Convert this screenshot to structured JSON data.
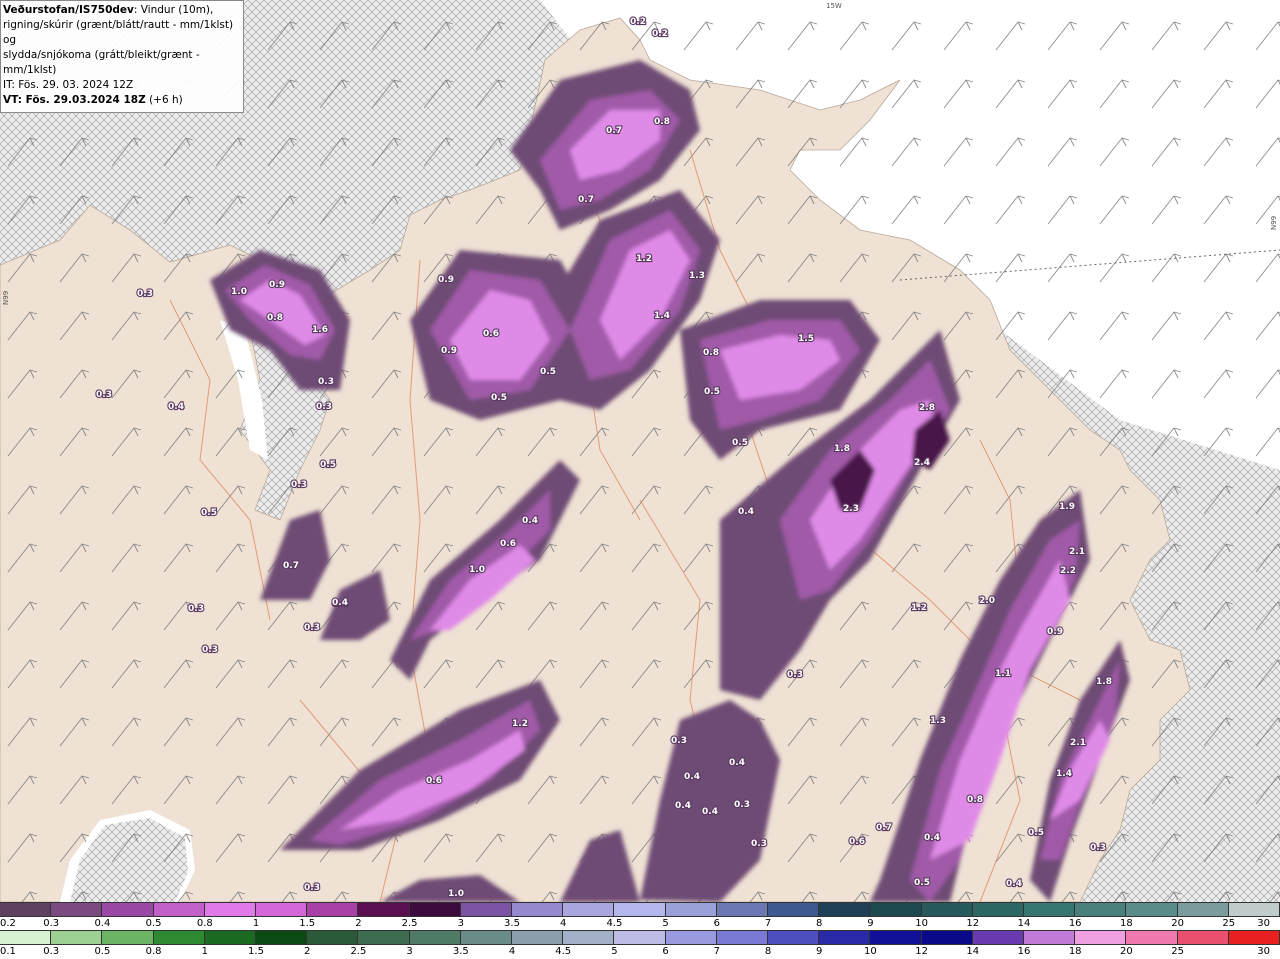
{
  "header": {
    "model": "Veðurstofan/IS750dev",
    "desc1": ": Vindur (10m),",
    "desc2": "rigning/skúrir (grænt/blátt/rautt - mm/1klst) og",
    "desc3": "slydda/snjókoma (grátt/bleikt/grænt - mm/1klst)",
    "it_line": "IT: Fös. 29. 03. 2024 12Z",
    "vt_label": "VT: Fös. 29.03.2024 18Z",
    "vt_offset": "(+6 h)"
  },
  "map_labels": {
    "grid_top": "15W",
    "grid_left": "N99",
    "grid_right": "N99"
  },
  "precip_labels": [
    "0.2",
    "0.2",
    "0.7",
    "0.8",
    "0.7",
    "1.2",
    "1.3",
    "1.4",
    "0.8",
    "1.5",
    "0.5",
    "0.5",
    "0.9",
    "0.9",
    "0.6",
    "0.5",
    "0.5",
    "0.3",
    "1.0",
    "0.9",
    "0.8",
    "1.6",
    "0.3",
    "0.3",
    "0.3",
    "0.4",
    "0.5",
    "0.3",
    "0.5",
    "0.7",
    "0.3",
    "0.3",
    "0.4",
    "0.3",
    "0.4",
    "0.6",
    "1.0",
    "1.8",
    "2.8",
    "2.4",
    "2.3",
    "0.4",
    "1.9",
    "2.1",
    "2.2",
    "1.2",
    "2.0",
    "0.9",
    "1.1",
    "1.8",
    "1.3",
    "2.1",
    "1.4",
    "0.8",
    "0.7",
    "0.6",
    "0.5",
    "0.4",
    "0.4",
    "0.3",
    "1.2",
    "0.6",
    "0.3",
    "0.4",
    "0.4",
    "0.4",
    "0.4",
    "0.3",
    "0.3",
    "0.3",
    "1.0",
    "0.3",
    "0.5",
    "0.4"
  ],
  "legend_rain": {
    "ticks": [
      "0.2",
      "0.3",
      "0.4",
      "0.5",
      "0.8",
      "1",
      "1.5",
      "2",
      "2.5",
      "3",
      "3.5",
      "4",
      "4.5",
      "5",
      "6",
      "7",
      "8",
      "9",
      "10",
      "12",
      "14",
      "16",
      "18",
      "20",
      "25",
      "30"
    ],
    "colors": [
      "#5e4060",
      "#7a4a80",
      "#9a4aa4",
      "#c060c8",
      "#e07ae8",
      "#d468d8",
      "#a840a8",
      "#5a1050",
      "#3c0a3c",
      "#7c52a4",
      "#9688cc",
      "#aaa6e0",
      "#b6b6ee",
      "#9aa0d8",
      "#6c78b4",
      "#3e5890",
      "#204058",
      "#1c4850",
      "#265a5c",
      "#2e6864",
      "#387672",
      "#4a807c",
      "#5a8c8a",
      "#7a9c9c",
      "#c0cccc"
    ]
  },
  "legend_snow": {
    "ticks": [
      "0.1",
      "0.3",
      "0.5",
      "0.8",
      "1",
      "1.5",
      "2",
      "2.5",
      "3",
      "3.5",
      "4",
      "4.5",
      "5",
      "6",
      "7",
      "8",
      "9",
      "10",
      "12",
      "14",
      "16",
      "18",
      "20",
      "25",
      "30"
    ],
    "colors": [
      "#d6f2d0",
      "#9ed094",
      "#6ab464",
      "#2e8a30",
      "#1a6a22",
      "#0c4a14",
      "#2a5a3a",
      "#3e6c50",
      "#4e7a66",
      "#6a8c88",
      "#8a9eac",
      "#a4b0c8",
      "#bcbce4",
      "#9a9ae0",
      "#7a7ad4",
      "#4e4ec0",
      "#2a2aa8",
      "#101098",
      "#0a0a88",
      "#6a3ab0",
      "#c07ad8",
      "#f0a0e0",
      "#f07ab0",
      "#e8506e",
      "#e82020"
    ]
  }
}
